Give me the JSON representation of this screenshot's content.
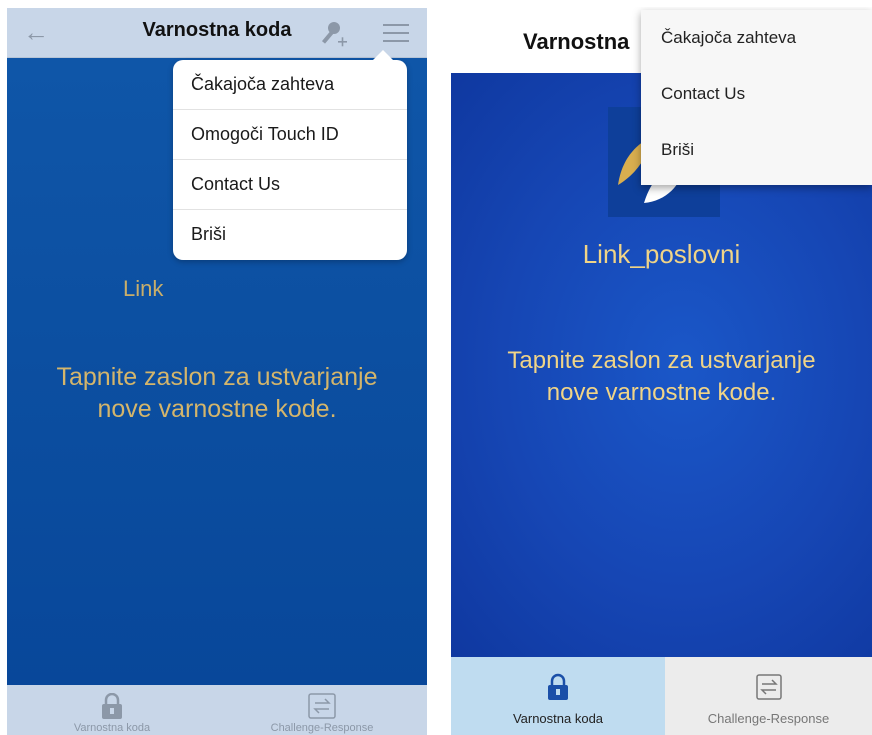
{
  "left_phone": {
    "header": {
      "title": "Varnostna koda",
      "back_icon": "arrow-left-icon",
      "add_key_icon": "key-plus-icon",
      "menu_icon": "hamburger-icon"
    },
    "body": {
      "token_name_partial": "Link",
      "prompt": "Tapnite zaslon za ustvarjanje nove varnostne kode."
    },
    "menu": {
      "items": [
        {
          "label": "Čakajoča zahteva"
        },
        {
          "label": "Omogoči Touch ID"
        },
        {
          "label": "Contact Us"
        },
        {
          "label": "Briši"
        }
      ]
    },
    "tabbar": {
      "tabs": [
        {
          "label": "Varnostna koda",
          "icon": "lock-icon"
        },
        {
          "label": "Challenge-Response",
          "icon": "swap-arrows-icon"
        }
      ]
    },
    "colors": {
      "accent": "#d4b56b",
      "background": "#0a4ea0",
      "bar": "#c8d6e8"
    }
  },
  "right_phone": {
    "header": {
      "title_partial": "Varnostna"
    },
    "body": {
      "logo_icon": "app-logo-icon",
      "token_name": "Link_poslovni",
      "prompt": "Tapnite zaslon za ustvarjanje nove varnostne kode."
    },
    "menu": {
      "items": [
        {
          "label": "Čakajoča zahteva"
        },
        {
          "label": "Contact Us"
        },
        {
          "label": "Briši"
        }
      ]
    },
    "tabbar": {
      "tabs": [
        {
          "label": "Varnostna koda",
          "icon": "lock-icon",
          "active": true
        },
        {
          "label": "Challenge-Response",
          "icon": "swap-arrows-icon",
          "active": false
        }
      ]
    },
    "colors": {
      "accent": "#f0d487",
      "background": "#1546b8",
      "active_tab": "#bfdcf0"
    }
  }
}
